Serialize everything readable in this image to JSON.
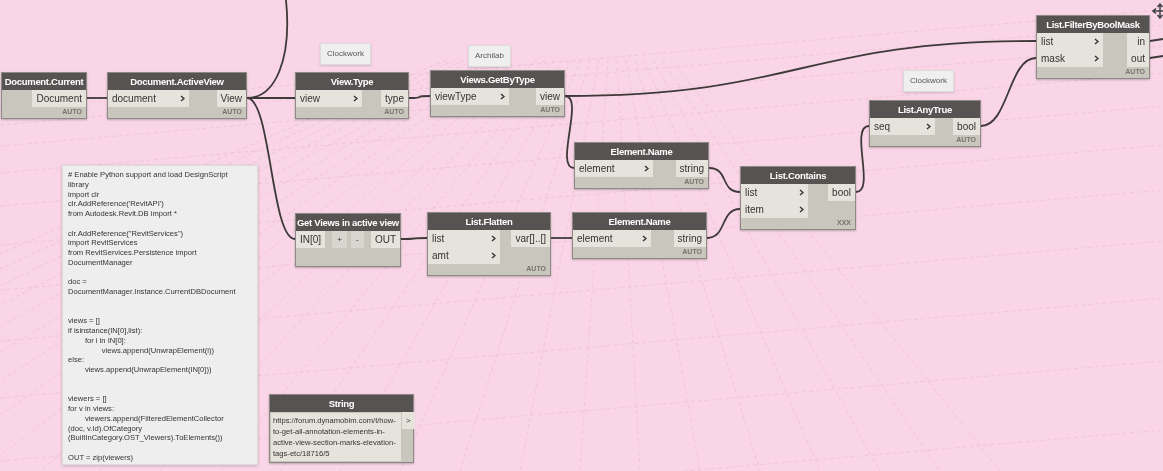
{
  "nodes": [
    {
      "title": "Document.Current",
      "outputs": [
        "Document"
      ],
      "footer": "AUTO"
    },
    {
      "title": "Document.ActiveView",
      "inputs": [
        "document"
      ],
      "outputs": [
        "View"
      ],
      "footer": "AUTO"
    },
    {
      "title": "View.Type",
      "tag": "Clockwork",
      "inputs": [
        "view"
      ],
      "outputs": [
        "type"
      ],
      "footer": "AUTO"
    },
    {
      "title": "Views.GetByType",
      "tag": "Archilab",
      "inputs": [
        "viewType"
      ],
      "outputs": [
        "view"
      ],
      "footer": "AUTO"
    },
    {
      "title": "List.FilterByBoolMask",
      "inputs": [
        "list",
        "mask"
      ],
      "outputs": [
        "in",
        "out"
      ],
      "footer": "AUTO"
    },
    {
      "title": "List.AnyTrue",
      "tag": "Clockwork",
      "inputs": [
        "seq"
      ],
      "outputs": [
        "bool"
      ],
      "footer": "AUTO"
    },
    {
      "title": "Element.Name",
      "inputs": [
        "element"
      ],
      "outputs": [
        "string"
      ],
      "footer": "AUTO"
    },
    {
      "title": "List.Contains",
      "inputs": [
        "list",
        "item"
      ],
      "outputs": [
        "bool"
      ],
      "footer": "XXX"
    },
    {
      "title": "Get Views in active view",
      "kind": "python",
      "inputs": [
        "IN[0]"
      ],
      "controls": [
        "+",
        "-"
      ],
      "outputs": [
        "OUT"
      ]
    },
    {
      "title": "List.Flatten",
      "inputs": [
        "list",
        "amt"
      ],
      "outputs": [
        "var[]..[]"
      ],
      "footer": "AUTO"
    },
    {
      "title": "Element.Name",
      "inputs": [
        "element"
      ],
      "outputs": [
        "string"
      ],
      "footer": "AUTO"
    },
    {
      "title": "String",
      "kind": "string",
      "value": "https://forum.dynamobim.com/t/how-to-get-all-annotation-elements-in-active-view-section-marks-elevation-tags-etc/18716/5",
      "outputs": [
        ">"
      ]
    }
  ],
  "note": {
    "text": "# Enable Python support and load DesignScript\nlibrary\nimport clr\nclr.AddReference('RevitAPI')\nfrom Autodesk.Revit.DB import *\n\nclr.AddReference(\"RevitServices\")\nimport RevitServices\nfrom RevitServices.Persistence import\nDocumentManager\n\ndoc =\nDocumentManager.Instance.CurrentDBDocument\n\n\nviews = []\nif isinstance(IN[0],list):\n\t\tfor i in IN[0]:\n\t\t\t\tviews.append(UnwrapElement(i))\nelse:\n\t\tviews.append(UnwrapElement(IN[0]))\n\n\nviewers = []\nfor v in views:\n\t\tviewers.append(FilteredElementCollector\n(doc, v.Id).OfCategory\n(BuiltInCategory.OST_Viewers).ToElements())\n\nOUT = zip(viewers)"
  }
}
